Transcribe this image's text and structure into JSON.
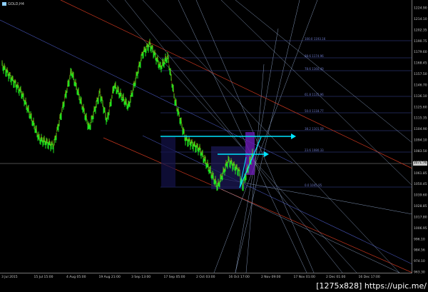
{
  "symbol": {
    "label": "GOLD,H4"
  },
  "price_axis": {
    "ticks": [
      "1224.90",
      "1214.10",
      "1202.35",
      "1190.75",
      "1179.60",
      "1168.45",
      "1157.50",
      "1146.70",
      "1136.10",
      "1125.60",
      "1115.35",
      "1104.90",
      "1094.10",
      "1083.50",
      "1072.70",
      "1061.85",
      "1050.45",
      "1039.60",
      "1028.85",
      "1017.80",
      "1006.95",
      "996.10",
      "984.56",
      "974.10",
      "963.30"
    ],
    "current_price": "1071.76"
  },
  "date_axis": {
    "ticks": [
      "3 Jul 2015",
      "15 Jul 15:00",
      "4 Aug 05:00",
      "19 Aug 21:00",
      "3 Sep 13:00",
      "17 Sep 05:00",
      "2 Oct 03:00",
      "16 Oct 17:00",
      "2 Nov 09:00",
      "17 Nov 01:00",
      "2 Dec 01:00",
      "16 Dec 17:00"
    ]
  },
  "fib_levels": [
    {
      "label": "100.0  1193.16"
    },
    {
      "label": "88.6  1174.96"
    },
    {
      "label": "78.6  1160.40"
    },
    {
      "label": "61.8  1135.96"
    },
    {
      "label": "50.0  1118.77"
    },
    {
      "label": "38.2  1101.59"
    },
    {
      "label": "23.6  1080.33"
    },
    {
      "label": "0.0  1045.95"
    }
  ],
  "colors": {
    "candles": "#22ff22",
    "ma": "#ff6a00",
    "channel_red": "#c8361e",
    "channel_blue": "#4654b8",
    "gann_lines": "#8ea5c9",
    "fib_lines": "#3d4aa0",
    "arrow": "#00e5ff",
    "box": "#6a1bb4"
  },
  "watermark": "[1275x828] https://upic.me/"
}
